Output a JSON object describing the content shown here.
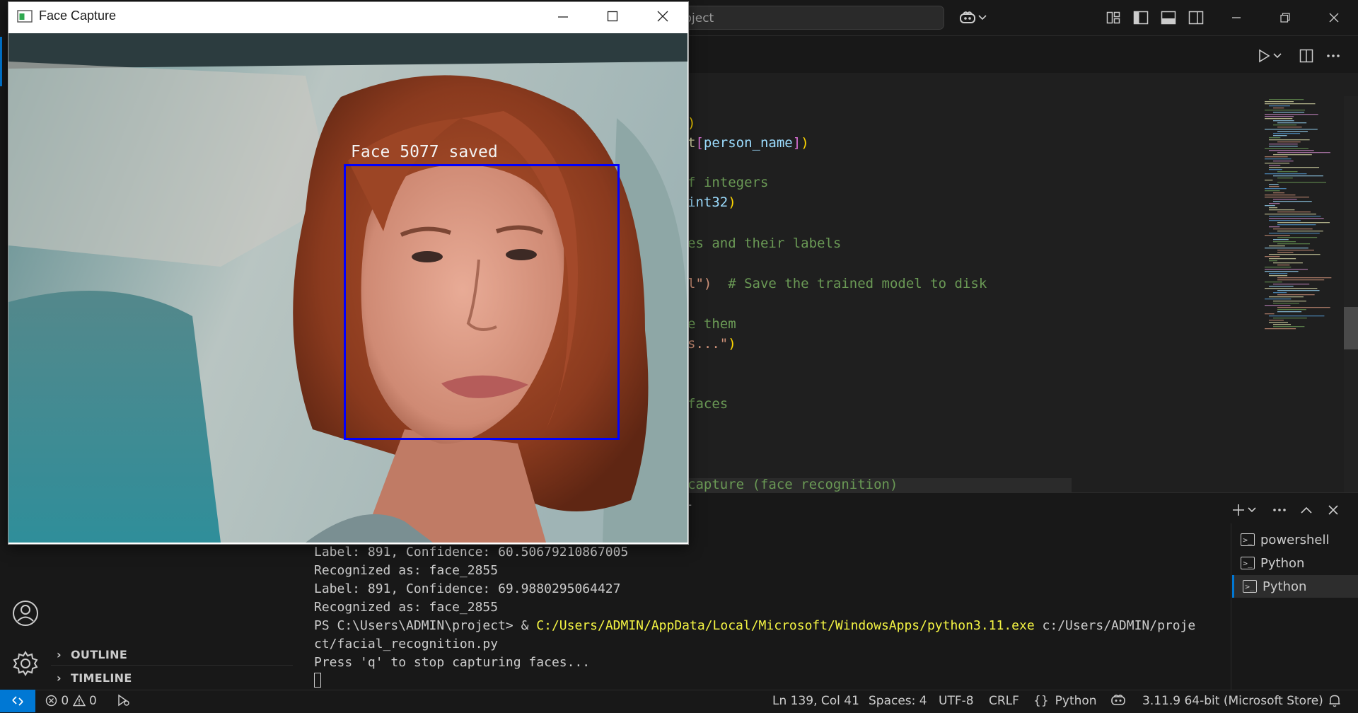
{
  "vscode": {
    "command_center_text": "roject",
    "editor": {
      "code_lines": [
        {
          "text": ")",
          "color": "#ffd700"
        },
        {
          "segments": [
            {
              "t": "t",
              "c": "#dcdcaa"
            },
            {
              "t": "[",
              "c": "#da70d6"
            },
            {
              "t": "person_name",
              "c": "#9cdcfe"
            },
            {
              "t": "]",
              "c": "#da70d6"
            },
            {
              "t": ")",
              "c": "#ffd700"
            }
          ]
        },
        {
          "text": "f integers",
          "color": "#6a9955"
        },
        {
          "segments": [
            {
              "t": "int32",
              "c": "#9cdcfe"
            },
            {
              "t": ")",
              "c": "#ffd700"
            }
          ]
        },
        {
          "text": "es and their labels",
          "color": "#6a9955"
        },
        {
          "segments": [
            {
              "t": "l\")",
              "c": "#ce9178"
            },
            {
              "t": "  # Save the trained model to disk",
              "c": "#6a9955"
            }
          ]
        },
        {
          "text": "e them",
          "color": "#6a9955"
        },
        {
          "segments": [
            {
              "t": "s...\"",
              "c": "#ce9178"
            },
            {
              "t": ")",
              "c": "#ffd700"
            }
          ]
        },
        {
          "text": "faces",
          "color": "#6a9955"
        },
        {
          "text": "capture (face recognition)",
          "color": "#6a9955"
        }
      ]
    },
    "sidebar": {
      "sections": [
        {
          "label": "OUTLINE"
        },
        {
          "label": "TIMELINE"
        }
      ]
    },
    "panel": {
      "tab_fragment": "T",
      "terminal_lines": [
        "Label: 891, Confidence: 60.50679210867005",
        "Recognized as: face_2855",
        "Label: 891, Confidence: 69.9880295064427",
        "Recognized as: face_2855"
      ],
      "command_line": {
        "prompt": "PS C:\\Users\\ADMIN\\project> & ",
        "exe": "C:/Users/ADMIN/AppData/Local/Microsoft/WindowsApps/python3.11.exe",
        "arg_start": " c:/Users/ADMIN/proje",
        "arg_end": "ct/facial_recognition.py"
      },
      "output_line": "Press 'q' to stop capturing faces...",
      "terminals": [
        {
          "label": "powershell",
          "active": false
        },
        {
          "label": "Python",
          "active": false
        },
        {
          "label": "Python",
          "active": true
        }
      ]
    },
    "statusbar": {
      "errors": "0",
      "warnings": "0",
      "position": "Ln 139, Col 41",
      "spaces": "Spaces: 4",
      "encoding": "UTF-8",
      "eol": "CRLF",
      "language": "Python",
      "interpreter": "3.11.9 64-bit (Microsoft Store)"
    }
  },
  "face_capture": {
    "window_title": "Face Capture",
    "overlay_label": "Face 5077 saved",
    "box_color": "#0000ff"
  }
}
